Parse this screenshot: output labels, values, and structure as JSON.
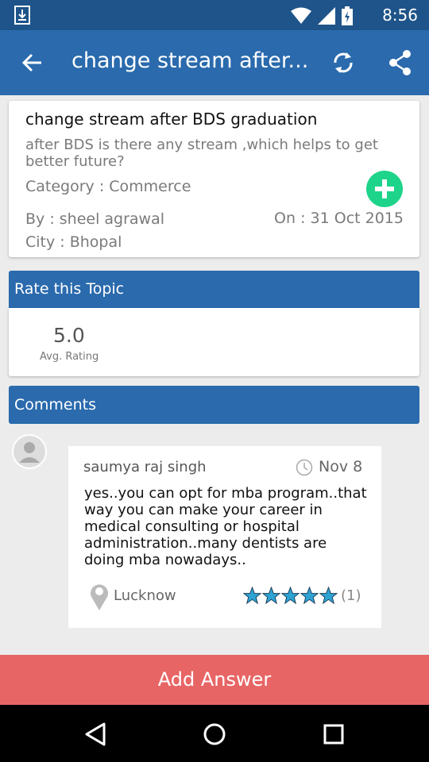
{
  "status_bar": {
    "time": "8:56",
    "icons": [
      "download-icon",
      "wifi-icon",
      "cell-signal-icon",
      "battery-charging-icon"
    ]
  },
  "app_bar": {
    "title": "change stream after...",
    "icons": [
      "back-arrow-icon",
      "refresh-icon",
      "share-icon"
    ]
  },
  "question": {
    "title": "change stream after BDS graduation",
    "body": "after BDS is there any stream ,which helps to get better future?",
    "category": "Category : Commerce",
    "by": "By : sheel agrawal",
    "date": "On : 31 Oct 2015",
    "city": "City : Bhopal",
    "add_icon": "plus-circle-icon",
    "add_color": "#1ed48a"
  },
  "rating": {
    "header": "Rate this Topic",
    "value": "5.0",
    "label": "Avg. Rating"
  },
  "comments": {
    "header": "Comments",
    "items": [
      {
        "author": "saumya raj singh",
        "date": "Nov 8",
        "text": "yes..you can opt for mba program..that way you can make your career in medical consulting or hospital administration..many dentists are doing mba nowadays..",
        "city": "Lucknow",
        "stars": 5,
        "rating_count": "(1)"
      }
    ]
  },
  "add_answer": {
    "label": "Add Answer",
    "color": "#e86565"
  },
  "nav_bar": {
    "icons": [
      "nav-back-icon",
      "nav-home-icon",
      "nav-recents-icon"
    ]
  },
  "colors": {
    "status_bar": "#1e5489",
    "app_bar": "#2a6aad",
    "star": "#2ea3d4"
  }
}
